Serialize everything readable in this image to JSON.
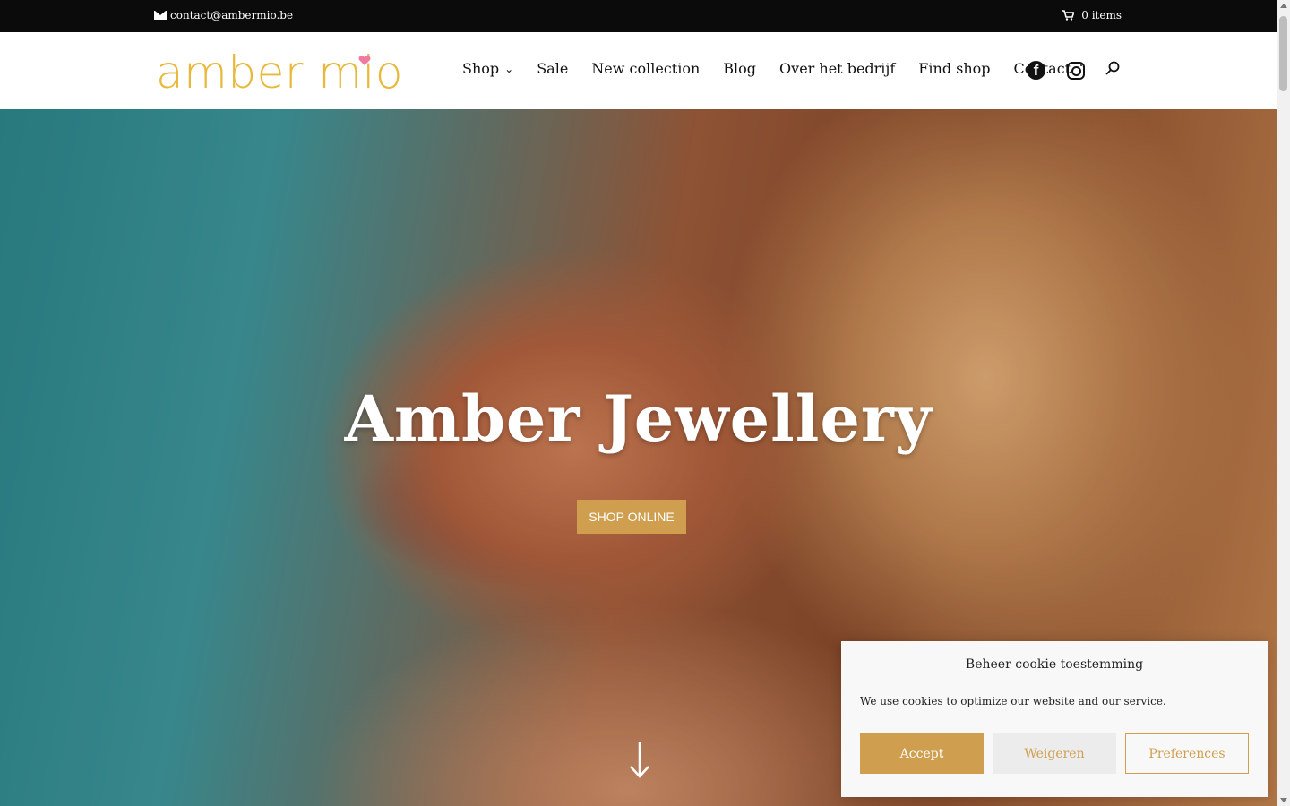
{
  "topbar": {
    "email": "contact@ambermio.be",
    "cart": "0 items"
  },
  "header": {
    "logo_text": "amber mio",
    "nav": [
      "Shop",
      "Sale",
      "New collection",
      "Blog",
      "Over het bedrijf",
      "Find shop",
      "Contact"
    ]
  },
  "hero": {
    "title": "Amber Jewellery",
    "button": "SHOP ONLINE"
  },
  "cookie": {
    "title": "Beheer cookie toestemming",
    "text": "We use cookies to optimize our website and our service.",
    "accept": "Accept",
    "deny": "Weigeren",
    "preferences": "Preferences"
  },
  "colors": {
    "accent": "#cf9f4f",
    "logo": "#e8b83a",
    "topbar": "#0b0b0b"
  },
  "icons": [
    "envelope-icon",
    "cart-icon",
    "chevron-down-icon",
    "facebook-icon",
    "instagram-icon",
    "search-icon",
    "arrow-down-icon"
  ]
}
